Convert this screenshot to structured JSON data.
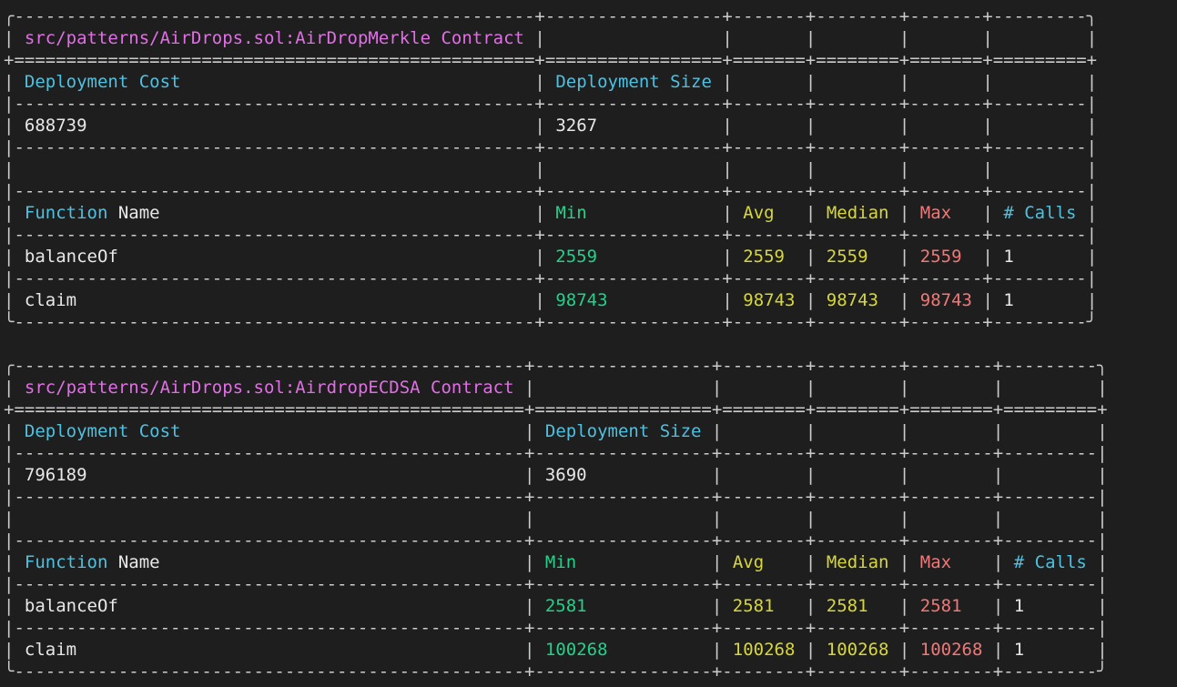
{
  "colors": {
    "background": "#1e1e1e",
    "border": "#cccccc",
    "title": "#e26ee6",
    "header": "#4fc1e0",
    "value": "#e8e8e8",
    "min": "#23d18b",
    "avg": "#d7d73a",
    "median": "#d7d73a",
    "max": "#f07878"
  },
  "labels": {
    "deployment_cost": "Deployment Cost",
    "deployment_size": "Deployment Size",
    "function_name_a": "Function",
    "function_name_b": "Name",
    "min": "Min",
    "avg": "Avg",
    "median": "Median",
    "max": "Max",
    "calls": "# Calls"
  },
  "reports": [
    {
      "title": "src/patterns/AirDrops.sol:AirDropMerkle Contract",
      "deployment_cost": "688739",
      "deployment_size": "3267",
      "functions": [
        {
          "name": "balanceOf",
          "min": "2559",
          "avg": "2559",
          "median": "2559",
          "max": "2559",
          "calls": "1"
        },
        {
          "name": "claim",
          "min": "98743",
          "avg": "98743",
          "median": "98743",
          "max": "98743",
          "calls": "1"
        }
      ]
    },
    {
      "title": "src/patterns/AirDrops.sol:AirdropECDSA Contract",
      "deployment_cost": "796189",
      "deployment_size": "3690",
      "functions": [
        {
          "name": "balanceOf",
          "min": "2581",
          "avg": "2581",
          "median": "2581",
          "max": "2581",
          "calls": "1"
        },
        {
          "name": "claim",
          "min": "100268",
          "avg": "100268",
          "median": "100268",
          "max": "100268",
          "calls": "1"
        }
      ]
    }
  ]
}
